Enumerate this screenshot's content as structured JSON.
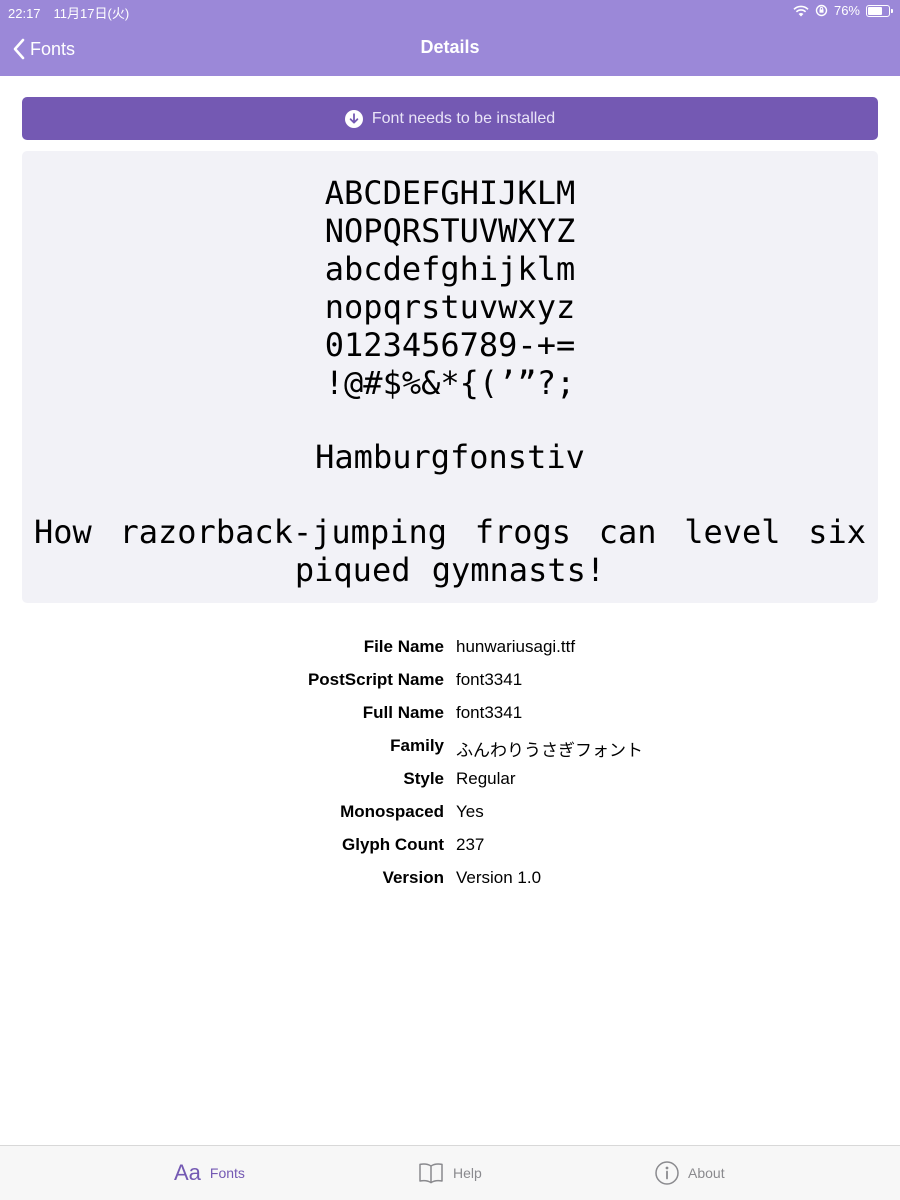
{
  "status_bar": {
    "time": "22:17　11月17日(火)",
    "battery": "76%",
    "battery_level": 0.76
  },
  "nav": {
    "back_label": "Fonts",
    "title": "Details"
  },
  "install_banner": {
    "label": "Font needs to be installed"
  },
  "preview": {
    "lines": [
      "ABCDEFGHIJKLM",
      "NOPQRSTUVWXYZ",
      "abcdefghijklm",
      "nopqrstuvwxyz",
      "0123456789-+=",
      "!@#$%&*{(’”?;",
      "Hamburgfonstiv"
    ],
    "pangram": "How razorback-jumping frogs can level six piqued gymnasts!"
  },
  "info": [
    {
      "label": "File Name",
      "value": "hunwariusagi.ttf"
    },
    {
      "label": "PostScript Name",
      "value": "font3341"
    },
    {
      "label": "Full Name",
      "value": "font3341"
    },
    {
      "label": "Family",
      "value": "ふんわりうさぎフォント"
    },
    {
      "label": "Style",
      "value": "Regular"
    },
    {
      "label": "Monospaced",
      "value": "Yes"
    },
    {
      "label": "Glyph Count",
      "value": "237"
    },
    {
      "label": "Version",
      "value": "Version 1.0"
    }
  ],
  "tabs": [
    {
      "icon_text": "Aa",
      "label": "Fonts",
      "icon": "font-icon"
    },
    {
      "label": "Help",
      "icon": "book-icon"
    },
    {
      "label": "About",
      "icon": "info-icon"
    }
  ],
  "colors": {
    "nav_bg": "#9b88d8",
    "accent": "#7459b3",
    "preview_bg": "#f2f2f7"
  }
}
